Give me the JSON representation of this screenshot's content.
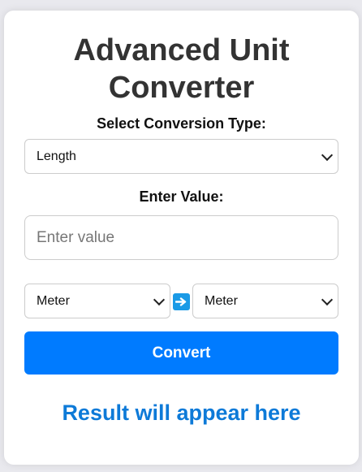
{
  "app": {
    "title_line1": "Advanced Unit",
    "title_line2": "Converter"
  },
  "conversion_type": {
    "label": "Select Conversion Type:",
    "selected": "Length"
  },
  "value": {
    "label": "Enter Value:",
    "placeholder": "Enter value",
    "current": ""
  },
  "units": {
    "from_selected": "Meter",
    "to_selected": "Meter",
    "swap_icon": "right-arrow-icon"
  },
  "convert_button": {
    "label": "Convert"
  },
  "result": {
    "text": "Result will appear here"
  },
  "colors": {
    "accent": "#007bff",
    "result_text": "#0d7ad8",
    "arrow_bg": "#1a9ae6"
  }
}
